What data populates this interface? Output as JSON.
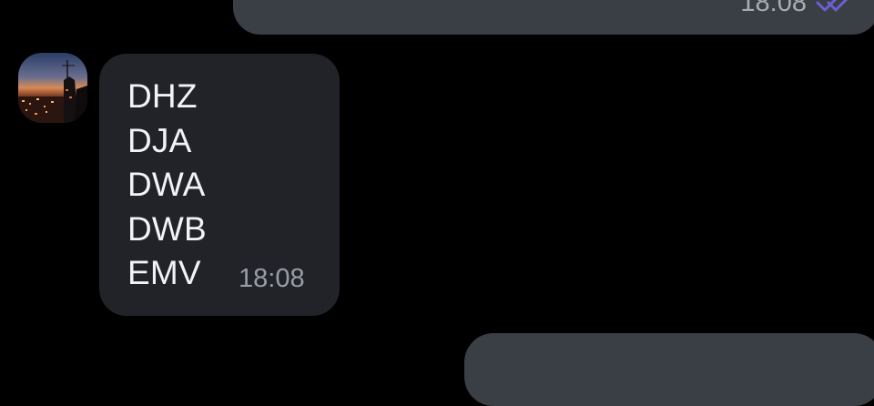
{
  "outgoing_top": {
    "time": "18:08",
    "status_icon": "double-check-icon"
  },
  "incoming": {
    "avatar_icon": "city-sunset-avatar",
    "lines": [
      "DHZ",
      "DJA",
      "DWA",
      "DWB",
      "EMV"
    ],
    "time": "18:08"
  },
  "colors": {
    "background": "#000000",
    "outgoing_bubble": "#3a3f46",
    "incoming_bubble": "#212328",
    "read_check": "#6b5fd3"
  }
}
